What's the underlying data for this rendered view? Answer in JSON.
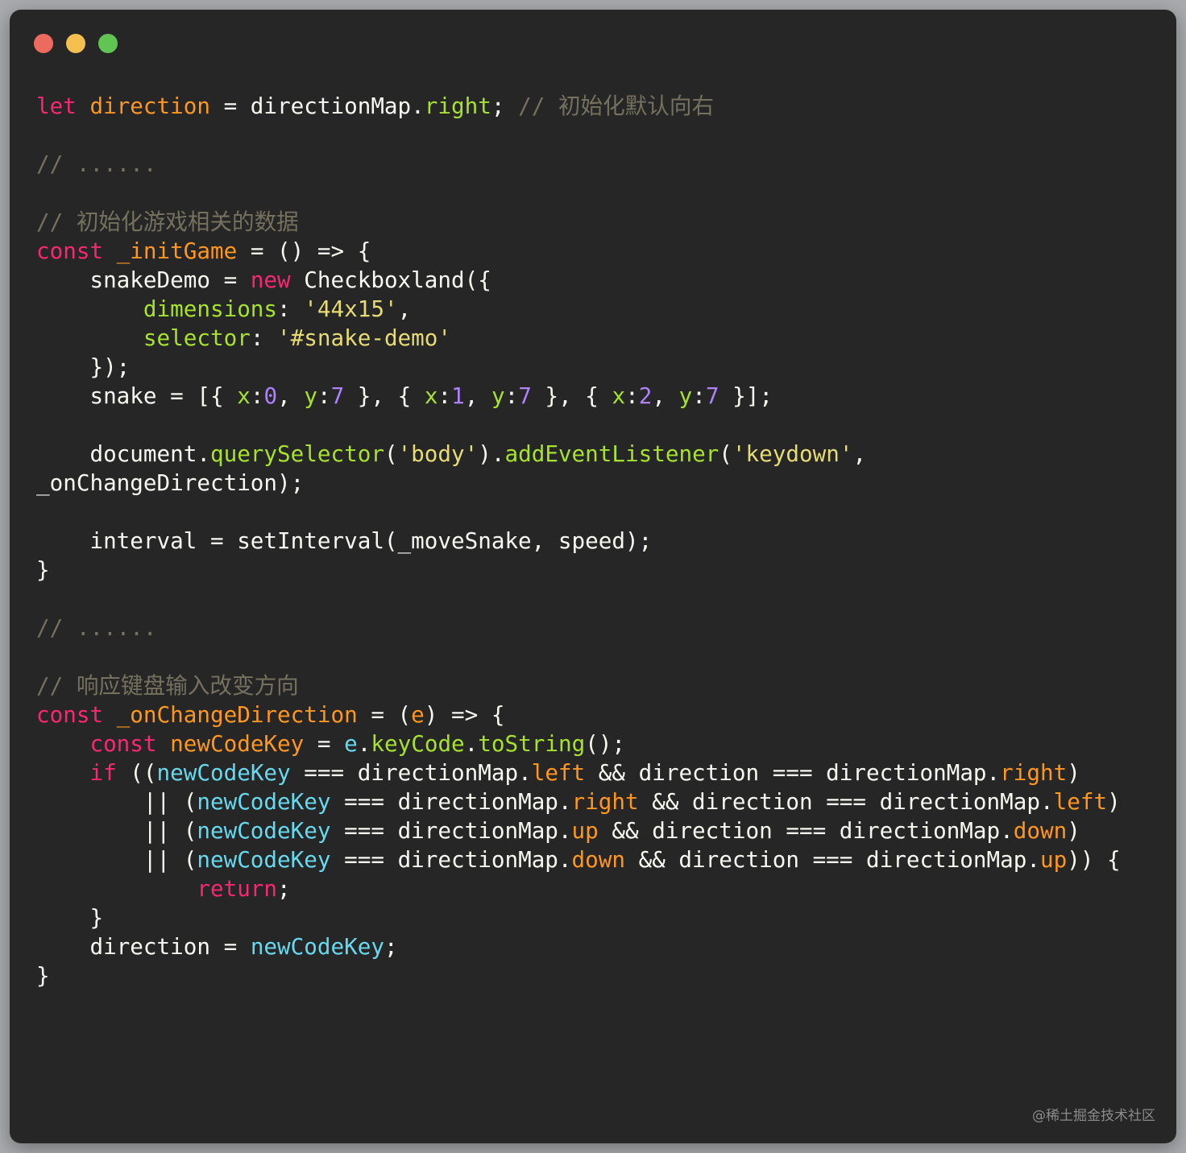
{
  "window": {
    "traffic_lights": [
      {
        "name": "close",
        "color": "#ed6a5e"
      },
      {
        "name": "minimize",
        "color": "#f5bf4f"
      },
      {
        "name": "zoom",
        "color": "#61c554"
      }
    ]
  },
  "code_lines": [
    [
      {
        "t": "let ",
        "c": "kw"
      },
      {
        "t": "direction",
        "c": "var"
      },
      {
        "t": " = directionMap.",
        "c": "pln"
      },
      {
        "t": "right",
        "c": "prop"
      },
      {
        "t": "; ",
        "c": "pln"
      },
      {
        "t": "// 初始化默认向右",
        "c": "cmt"
      }
    ],
    [],
    [
      {
        "t": "// ......",
        "c": "cmt"
      }
    ],
    [],
    [
      {
        "t": "// 初始化游戏相关的数据",
        "c": "cmt"
      }
    ],
    [
      {
        "t": "const ",
        "c": "kw"
      },
      {
        "t": "_initGame",
        "c": "var"
      },
      {
        "t": " = () => {",
        "c": "pln"
      }
    ],
    [
      {
        "t": "    snakeDemo = ",
        "c": "pln"
      },
      {
        "t": "new",
        "c": "kw"
      },
      {
        "t": " Checkboxland({",
        "c": "pln"
      }
    ],
    [
      {
        "t": "        ",
        "c": "pln"
      },
      {
        "t": "dimensions",
        "c": "prop"
      },
      {
        "t": ": ",
        "c": "pln"
      },
      {
        "t": "'44x15'",
        "c": "str"
      },
      {
        "t": ",",
        "c": "pln"
      }
    ],
    [
      {
        "t": "        ",
        "c": "pln"
      },
      {
        "t": "selector",
        "c": "prop"
      },
      {
        "t": ": ",
        "c": "pln"
      },
      {
        "t": "'#snake-demo'",
        "c": "str"
      }
    ],
    [
      {
        "t": "    });",
        "c": "pln"
      }
    ],
    [
      {
        "t": "    snake = [{ ",
        "c": "pln"
      },
      {
        "t": "x",
        "c": "prop"
      },
      {
        "t": ":",
        "c": "pln"
      },
      {
        "t": "0",
        "c": "num"
      },
      {
        "t": ", ",
        "c": "pln"
      },
      {
        "t": "y",
        "c": "prop"
      },
      {
        "t": ":",
        "c": "pln"
      },
      {
        "t": "7",
        "c": "num"
      },
      {
        "t": " }, { ",
        "c": "pln"
      },
      {
        "t": "x",
        "c": "prop"
      },
      {
        "t": ":",
        "c": "pln"
      },
      {
        "t": "1",
        "c": "num"
      },
      {
        "t": ", ",
        "c": "pln"
      },
      {
        "t": "y",
        "c": "prop"
      },
      {
        "t": ":",
        "c": "pln"
      },
      {
        "t": "7",
        "c": "num"
      },
      {
        "t": " }, { ",
        "c": "pln"
      },
      {
        "t": "x",
        "c": "prop"
      },
      {
        "t": ":",
        "c": "pln"
      },
      {
        "t": "2",
        "c": "num"
      },
      {
        "t": ", ",
        "c": "pln"
      },
      {
        "t": "y",
        "c": "prop"
      },
      {
        "t": ":",
        "c": "pln"
      },
      {
        "t": "7",
        "c": "num"
      },
      {
        "t": " }];",
        "c": "pln"
      }
    ],
    [],
    [
      {
        "t": "    document.",
        "c": "pln"
      },
      {
        "t": "querySelector",
        "c": "prop"
      },
      {
        "t": "(",
        "c": "pln"
      },
      {
        "t": "'body'",
        "c": "str"
      },
      {
        "t": ").",
        "c": "pln"
      },
      {
        "t": "addEventListener",
        "c": "prop"
      },
      {
        "t": "(",
        "c": "pln"
      },
      {
        "t": "'keydown'",
        "c": "str"
      },
      {
        "t": ",",
        "c": "pln"
      }
    ],
    [
      {
        "t": "_onChangeDirection);",
        "c": "pln"
      }
    ],
    [],
    [
      {
        "t": "    interval = setInterval(_moveSnake, speed);",
        "c": "pln"
      }
    ],
    [
      {
        "t": "}",
        "c": "pln"
      }
    ],
    [],
    [
      {
        "t": "// ......",
        "c": "cmt"
      }
    ],
    [],
    [
      {
        "t": "// 响应键盘输入改变方向",
        "c": "cmt"
      }
    ],
    [
      {
        "t": "const ",
        "c": "kw"
      },
      {
        "t": "_onChangeDirection",
        "c": "var"
      },
      {
        "t": " = (",
        "c": "pln"
      },
      {
        "t": "e",
        "c": "var"
      },
      {
        "t": ") => {",
        "c": "pln"
      }
    ],
    [
      {
        "t": "    ",
        "c": "pln"
      },
      {
        "t": "const ",
        "c": "kw"
      },
      {
        "t": "newCodeKey",
        "c": "var"
      },
      {
        "t": " = ",
        "c": "pln"
      },
      {
        "t": "e",
        "c": "cyn"
      },
      {
        "t": ".",
        "c": "pln"
      },
      {
        "t": "keyCode",
        "c": "prop"
      },
      {
        "t": ".",
        "c": "pln"
      },
      {
        "t": "toString",
        "c": "prop"
      },
      {
        "t": "();",
        "c": "pln"
      }
    ],
    [
      {
        "t": "    ",
        "c": "pln"
      },
      {
        "t": "if",
        "c": "kw"
      },
      {
        "t": " ((",
        "c": "pln"
      },
      {
        "t": "newCodeKey",
        "c": "cyn"
      },
      {
        "t": " === directionMap.",
        "c": "pln"
      },
      {
        "t": "left",
        "c": "var"
      },
      {
        "t": " && direction === directionMap.",
        "c": "pln"
      },
      {
        "t": "right",
        "c": "var"
      },
      {
        "t": ")",
        "c": "pln"
      }
    ],
    [
      {
        "t": "        || (",
        "c": "pln"
      },
      {
        "t": "newCodeKey",
        "c": "cyn"
      },
      {
        "t": " === directionMap.",
        "c": "pln"
      },
      {
        "t": "right",
        "c": "var"
      },
      {
        "t": " && direction === directionMap.",
        "c": "pln"
      },
      {
        "t": "left",
        "c": "var"
      },
      {
        "t": ")",
        "c": "pln"
      }
    ],
    [
      {
        "t": "        || (",
        "c": "pln"
      },
      {
        "t": "newCodeKey",
        "c": "cyn"
      },
      {
        "t": " === directionMap.",
        "c": "pln"
      },
      {
        "t": "up",
        "c": "var"
      },
      {
        "t": " && direction === directionMap.",
        "c": "pln"
      },
      {
        "t": "down",
        "c": "var"
      },
      {
        "t": ")",
        "c": "pln"
      }
    ],
    [
      {
        "t": "        || (",
        "c": "pln"
      },
      {
        "t": "newCodeKey",
        "c": "cyn"
      },
      {
        "t": " === directionMap.",
        "c": "pln"
      },
      {
        "t": "down",
        "c": "var"
      },
      {
        "t": " && direction === directionMap.",
        "c": "pln"
      },
      {
        "t": "up",
        "c": "var"
      },
      {
        "t": ")) {",
        "c": "pln"
      }
    ],
    [
      {
        "t": "            ",
        "c": "pln"
      },
      {
        "t": "return",
        "c": "kw"
      },
      {
        "t": ";",
        "c": "pln"
      }
    ],
    [
      {
        "t": "    }",
        "c": "pln"
      }
    ],
    [
      {
        "t": "    direction = ",
        "c": "pln"
      },
      {
        "t": "newCodeKey",
        "c": "cyn"
      },
      {
        "t": ";",
        "c": "pln"
      }
    ],
    [
      {
        "t": "}",
        "c": "pln"
      }
    ]
  ],
  "watermark": "@稀土掘金技术社区"
}
